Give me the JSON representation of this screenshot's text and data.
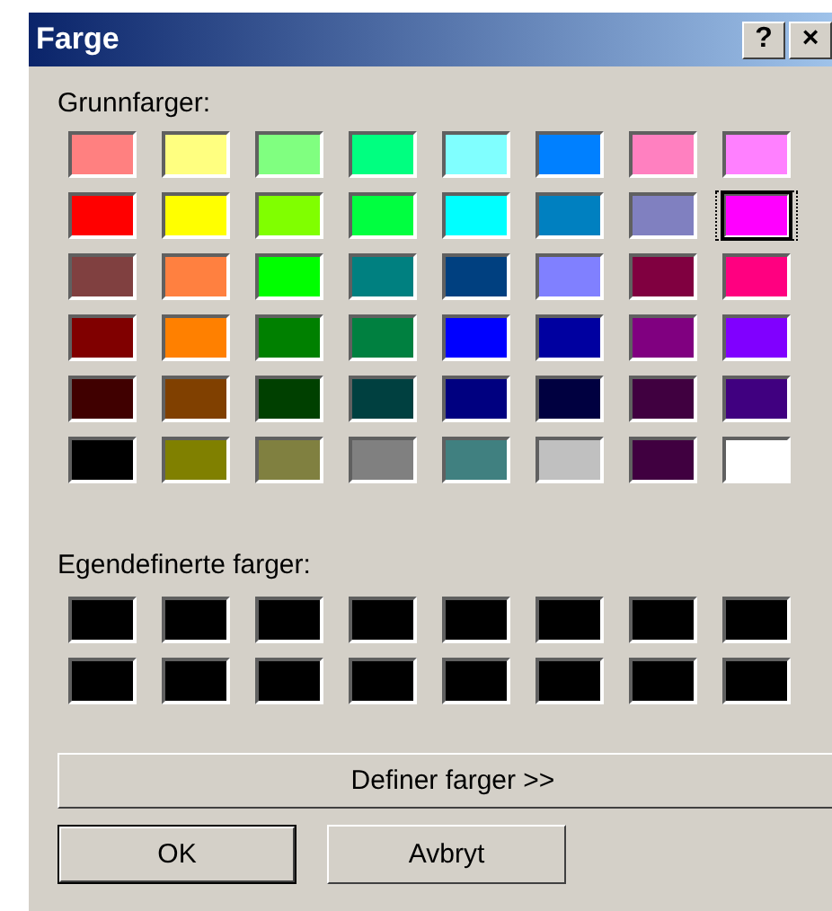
{
  "window": {
    "title": "Farge"
  },
  "title_buttons": [
    "?",
    "×"
  ],
  "basic_label": "Grunnfarger:",
  "basic_colors": [
    {
      "color": "#ff8080",
      "selected": false
    },
    {
      "color": "#ffff80",
      "selected": false
    },
    {
      "color": "#80ff80",
      "selected": false
    },
    {
      "color": "#00ff80",
      "selected": false
    },
    {
      "color": "#80ffff",
      "selected": false
    },
    {
      "color": "#0080ff",
      "selected": false
    },
    {
      "color": "#ff80c0",
      "selected": false
    },
    {
      "color": "#ff80ff",
      "selected": false
    },
    {
      "color": "#ff0000",
      "selected": false
    },
    {
      "color": "#ffff00",
      "selected": false
    },
    {
      "color": "#80ff00",
      "selected": false
    },
    {
      "color": "#00ff40",
      "selected": false
    },
    {
      "color": "#00ffff",
      "selected": false
    },
    {
      "color": "#0080c0",
      "selected": false
    },
    {
      "color": "#8080c0",
      "selected": false
    },
    {
      "color": "#ff00ff",
      "selected": true
    },
    {
      "color": "#804040",
      "selected": false
    },
    {
      "color": "#ff8040",
      "selected": false
    },
    {
      "color": "#00ff00",
      "selected": false
    },
    {
      "color": "#008080",
      "selected": false
    },
    {
      "color": "#004080",
      "selected": false
    },
    {
      "color": "#8080ff",
      "selected": false
    },
    {
      "color": "#800040",
      "selected": false
    },
    {
      "color": "#ff0080",
      "selected": false
    },
    {
      "color": "#800000",
      "selected": false
    },
    {
      "color": "#ff8000",
      "selected": false
    },
    {
      "color": "#008000",
      "selected": false
    },
    {
      "color": "#008040",
      "selected": false
    },
    {
      "color": "#0000ff",
      "selected": false
    },
    {
      "color": "#0000a0",
      "selected": false
    },
    {
      "color": "#800080",
      "selected": false
    },
    {
      "color": "#8000ff",
      "selected": false
    },
    {
      "color": "#400000",
      "selected": false
    },
    {
      "color": "#804000",
      "selected": false
    },
    {
      "color": "#004000",
      "selected": false
    },
    {
      "color": "#004040",
      "selected": false
    },
    {
      "color": "#000080",
      "selected": false
    },
    {
      "color": "#000040",
      "selected": false
    },
    {
      "color": "#400040",
      "selected": false
    },
    {
      "color": "#400080",
      "selected": false
    },
    {
      "color": "#000000",
      "selected": false
    },
    {
      "color": "#808000",
      "selected": false
    },
    {
      "color": "#808040",
      "selected": false
    },
    {
      "color": "#808080",
      "selected": false
    },
    {
      "color": "#408080",
      "selected": false
    },
    {
      "color": "#c0c0c0",
      "selected": false
    },
    {
      "color": "#400040",
      "selected": false
    },
    {
      "color": "#ffffff",
      "selected": false
    }
  ],
  "custom_label": "Egendefinerte farger:",
  "custom_colors": [
    {
      "color": "#000000"
    },
    {
      "color": "#000000"
    },
    {
      "color": "#000000"
    },
    {
      "color": "#000000"
    },
    {
      "color": "#000000"
    },
    {
      "color": "#000000"
    },
    {
      "color": "#000000"
    },
    {
      "color": "#000000"
    },
    {
      "color": "#000000"
    },
    {
      "color": "#000000"
    },
    {
      "color": "#000000"
    },
    {
      "color": "#000000"
    },
    {
      "color": "#000000"
    },
    {
      "color": "#000000"
    },
    {
      "color": "#000000"
    },
    {
      "color": "#000000"
    }
  ],
  "define_button": "Definer farger >>",
  "buttons": [
    {
      "label": "OK",
      "default": true
    },
    {
      "label": "Avbryt",
      "default": false
    }
  ]
}
